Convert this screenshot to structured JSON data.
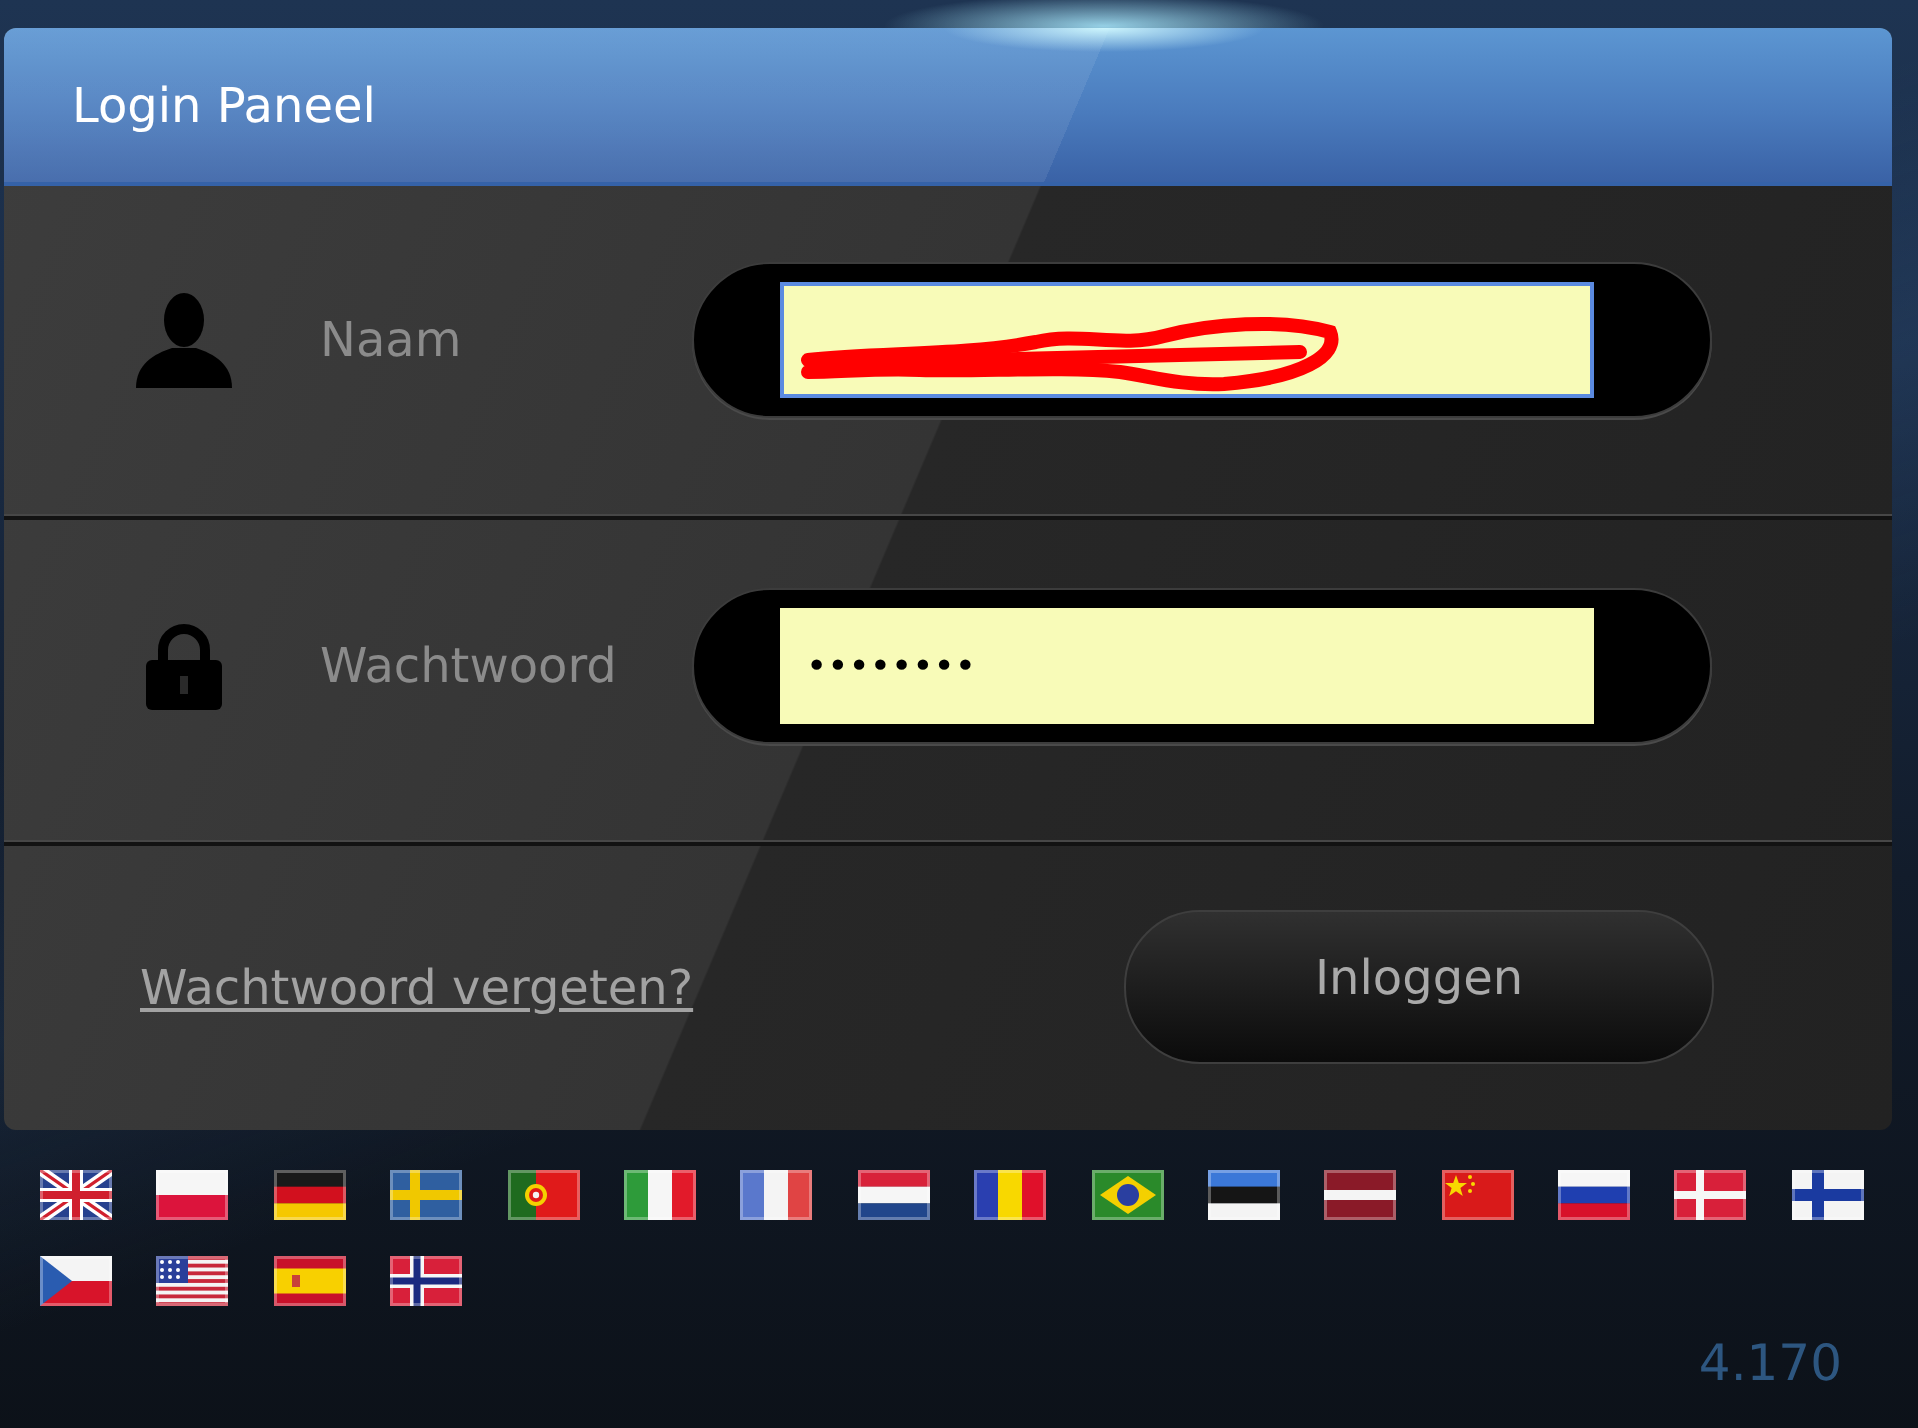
{
  "panel": {
    "title": "Login Paneel"
  },
  "fields": [
    {
      "kind": "username",
      "label": "Naam",
      "focused": true,
      "redacted": true
    },
    {
      "kind": "password",
      "label": "Wachtwoord",
      "value": "••••••••",
      "focused": false,
      "redacted": false
    }
  ],
  "forgot_password_link": "Wachtwoord vergeten?",
  "login_button": "Inloggen",
  "language_flags": [
    {
      "kind": "gb"
    },
    {
      "kind": "pl"
    },
    {
      "kind": "de"
    },
    {
      "kind": "se"
    },
    {
      "kind": "pt"
    },
    {
      "kind": "it"
    },
    {
      "kind": "fr"
    },
    {
      "kind": "nl"
    },
    {
      "kind": "ro"
    },
    {
      "kind": "br"
    },
    {
      "kind": "ee"
    },
    {
      "kind": "lv"
    },
    {
      "kind": "cn"
    },
    {
      "kind": "ru"
    },
    {
      "kind": "dk"
    },
    {
      "kind": "fi"
    },
    {
      "kind": "cz"
    },
    {
      "kind": "us"
    },
    {
      "kind": "es"
    },
    {
      "kind": "no"
    }
  ],
  "version": "4.170"
}
